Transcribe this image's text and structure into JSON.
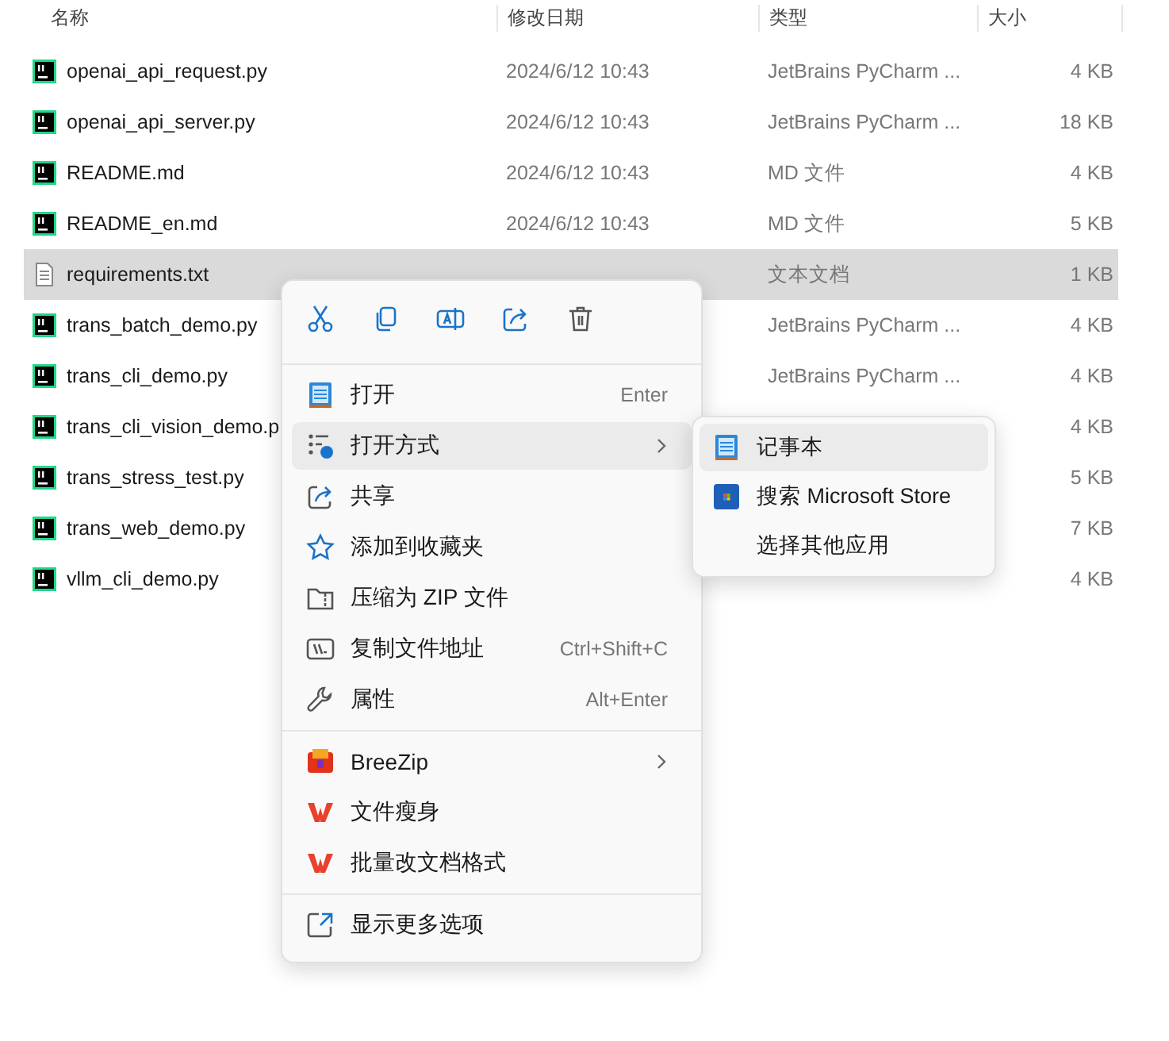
{
  "columns": [
    {
      "label": "名称"
    },
    {
      "label": "修改日期"
    },
    {
      "label": "类型"
    },
    {
      "label": "大小"
    }
  ],
  "files": [
    {
      "kind": "python",
      "name": "openai_api_request.py",
      "date": "2024/6/12 10:43",
      "type": "JetBrains PyCharm ...",
      "size": "4 KB",
      "selected": false
    },
    {
      "kind": "python",
      "name": "openai_api_server.py",
      "date": "2024/6/12 10:43",
      "type": "JetBrains PyCharm ...",
      "size": "18 KB",
      "selected": false
    },
    {
      "kind": "python",
      "name": "README.md",
      "date": "2024/6/12 10:43",
      "type": "MD 文件",
      "size": "4 KB",
      "selected": false
    },
    {
      "kind": "python",
      "name": "README_en.md",
      "date": "2024/6/12 10:43",
      "type": "MD 文件",
      "size": "5 KB",
      "selected": false
    },
    {
      "kind": "text",
      "name": "requirements.txt",
      "type": "文本文档",
      "size": "1 KB",
      "selected": true
    },
    {
      "kind": "python",
      "name": "trans_batch_demo.py",
      "type": "JetBrains PyCharm ...",
      "size": "4 KB",
      "selected": false
    },
    {
      "kind": "python",
      "name": "trans_cli_demo.py",
      "type": "JetBrains PyCharm ...",
      "size": "4 KB",
      "selected": false
    },
    {
      "kind": "python",
      "name": "trans_cli_vision_demo.p",
      "size": "4 KB",
      "selected": false
    },
    {
      "kind": "python",
      "name": "trans_stress_test.py",
      "size": "5 KB",
      "selected": false
    },
    {
      "kind": "python",
      "name": "trans_web_demo.py",
      "size": "7 KB",
      "selected": false
    },
    {
      "kind": "python",
      "name": "vllm_cli_demo.py",
      "size": "4 KB",
      "selected": false
    }
  ],
  "context_menu": {
    "groups": [
      [
        {
          "kind": "open",
          "label": "打开",
          "shortcut": "Enter",
          "has_submenu": false,
          "selected": false
        },
        {
          "kind": "open_with",
          "label": "打开方式",
          "has_submenu": true,
          "selected": true
        },
        {
          "kind": "share",
          "label": "共享",
          "has_submenu": false,
          "selected": false
        },
        {
          "kind": "favorite",
          "label": "添加到收藏夹",
          "has_submenu": false,
          "selected": false
        },
        {
          "kind": "zip",
          "label": "压缩为 ZIP 文件",
          "has_submenu": false,
          "selected": false
        },
        {
          "kind": "copy_path",
          "label": "复制文件地址",
          "shortcut": "Ctrl+Shift+C",
          "has_submenu": false,
          "selected": false
        },
        {
          "kind": "properties",
          "label": "属性",
          "shortcut": "Alt+Enter",
          "has_submenu": false,
          "selected": false
        }
      ],
      [
        {
          "kind": "breezip",
          "label": "BreeZip",
          "has_submenu": true,
          "selected": false
        },
        {
          "kind": "wps",
          "label": "文件瘦身",
          "has_submenu": false,
          "selected": false
        },
        {
          "kind": "wps",
          "label": "批量改文档格式",
          "has_submenu": false,
          "selected": false
        }
      ],
      [
        {
          "kind": "more",
          "label": "显示更多选项",
          "has_submenu": false,
          "selected": false
        }
      ]
    ]
  },
  "submenu": {
    "items": [
      {
        "kind": "notepad",
        "label": "记事本",
        "selected": true
      },
      {
        "kind": "store",
        "label": "搜索 Microsoft Store",
        "selected": false
      },
      {
        "kind": "none",
        "label": "选择其他应用",
        "selected": false
      }
    ]
  }
}
